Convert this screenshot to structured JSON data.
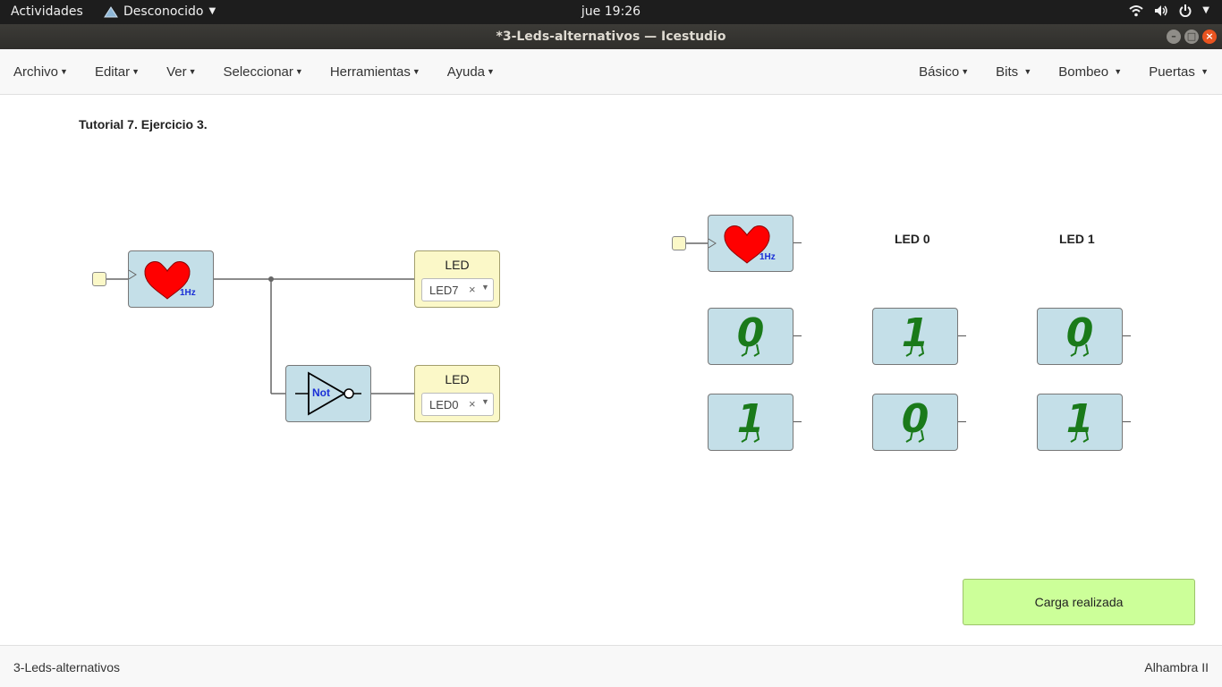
{
  "system_bar": {
    "activities": "Actividades",
    "app_name": "Desconocido",
    "clock": "jue 19:26",
    "icons": [
      "wifi-icon",
      "volume-icon",
      "power-icon"
    ]
  },
  "window": {
    "title": "*3-Leds-alternativos — Icestudio",
    "buttons": [
      "minimize",
      "maximize",
      "close"
    ]
  },
  "menu": {
    "left": [
      "Archivo",
      "Editar",
      "Ver",
      "Seleccionar",
      "Herramientas",
      "Ayuda"
    ],
    "right": [
      "Básico",
      "Bits",
      "Bombeo",
      "Puertas"
    ]
  },
  "canvas": {
    "comment": "Tutorial 7. Ejercicio 3.",
    "heart_freq": "1Hz",
    "not_label": "Not",
    "led_blocks": [
      {
        "title": "LED",
        "value": "LED7"
      },
      {
        "title": "LED",
        "value": "LED0"
      }
    ],
    "clear_symbol": "×",
    "table": {
      "heart_freq": "1Hz",
      "headers": [
        "LED 0",
        "LED 1"
      ],
      "rows": [
        [
          "0",
          "1",
          "0"
        ],
        [
          "1",
          "0",
          "1"
        ]
      ]
    },
    "toast": "Carga realizada"
  },
  "footer": {
    "file": "3-Leds-alternativos",
    "board": "Alhambra II"
  },
  "colors": {
    "block_blue": "#c4dfe8",
    "led_yellow": "#fbf8c8",
    "digit_green": "#1a7a1a",
    "heart_red": "#ff0000",
    "toast_green": "#ccff99",
    "ubuntu_orange": "#e95420"
  }
}
